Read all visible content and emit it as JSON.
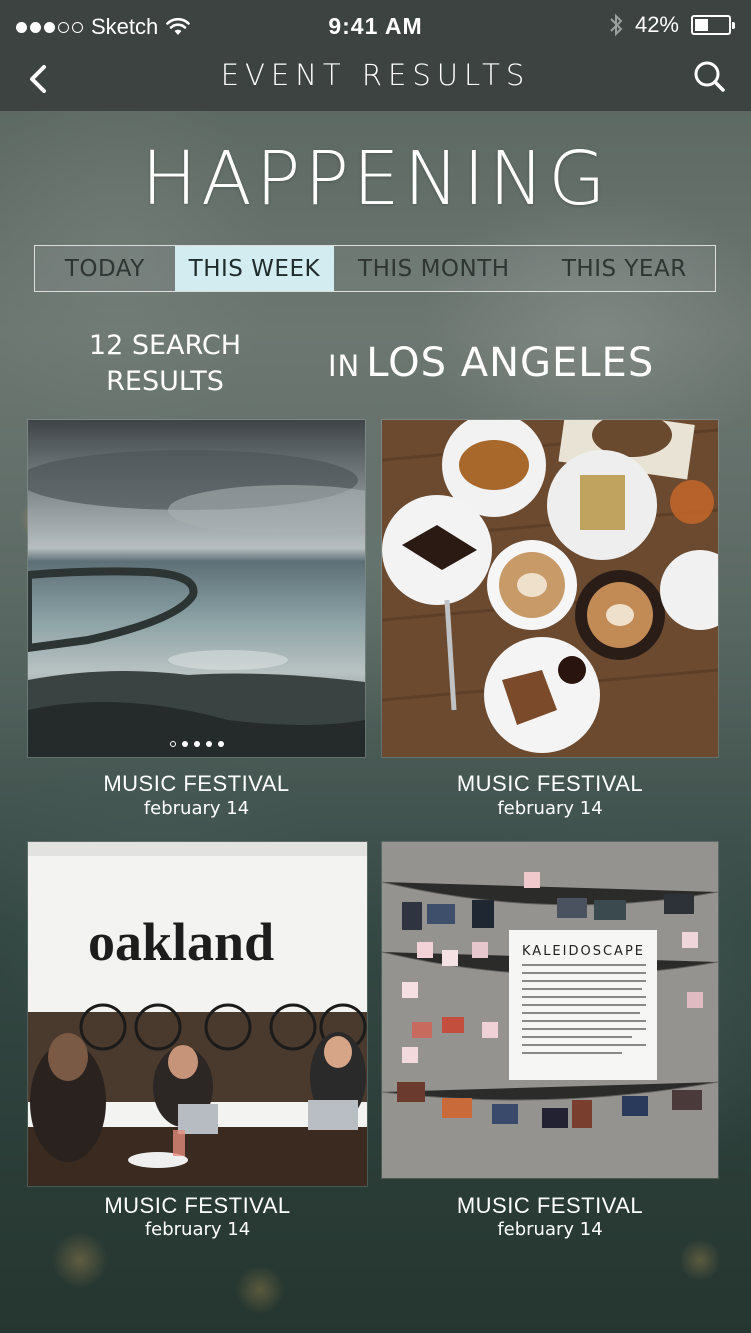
{
  "status_bar": {
    "carrier": "Sketch",
    "time": "9:41 AM",
    "battery": "42%",
    "battery_level": 0.42
  },
  "nav": {
    "title": "EVENT RESULTS",
    "back_icon": "chevron-left-icon",
    "search_icon": "search-icon"
  },
  "headline": "HAPPENING",
  "tabs": [
    {
      "label": "TODAY",
      "active": false
    },
    {
      "label": "THIS WEEK",
      "active": true
    },
    {
      "label": "THIS MONTH",
      "active": false
    },
    {
      "label": "THIS YEAR",
      "active": false
    }
  ],
  "results": {
    "count_line1": "12 SEARCH",
    "count_line2": "RESULTS",
    "in_label": "IN",
    "location": "LOS ANGELES"
  },
  "events": [
    {
      "name": "MUSIC FESTIVAL",
      "date": "february 14",
      "image": "seascape-photo",
      "pager_total": 5,
      "pager_active": 1
    },
    {
      "name": "MUSIC FESTIVAL",
      "date": "february 14",
      "image": "coffee-table-photo"
    },
    {
      "name": "MUSIC FESTIVAL",
      "date": "february 14",
      "image": "oakland-cafe-photo",
      "sign_text": "oakland"
    },
    {
      "name": "MUSIC FESTIVAL",
      "date": "february 14",
      "image": "kaleidoscope-wall-photo",
      "sign_text": "KALEIDOSCAPE"
    }
  ],
  "colors": {
    "nav_bar": "#3c4340",
    "active_tab": "#d3ecef",
    "tab_text": "#2e3532"
  }
}
